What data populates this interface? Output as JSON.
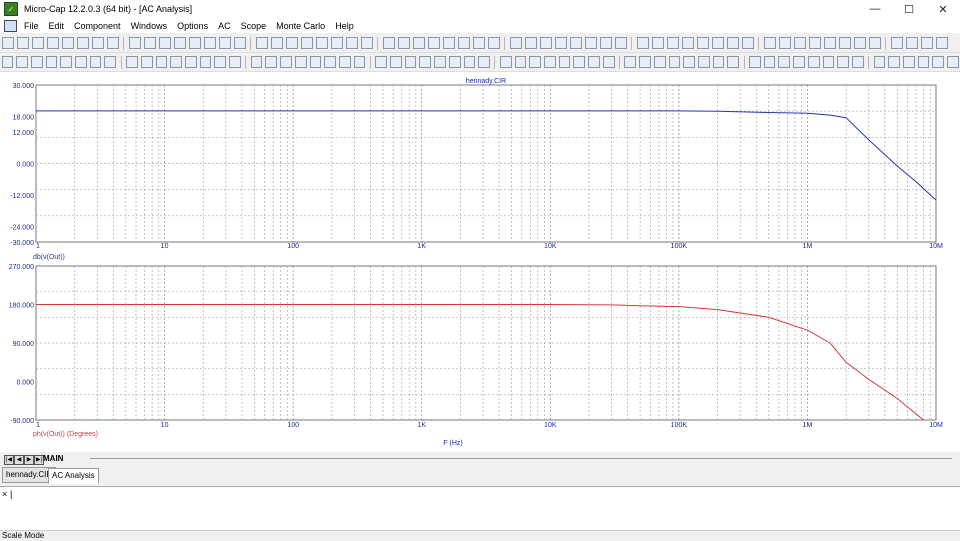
{
  "window": {
    "title": "Micro-Cap 12.2.0.3 (64 bit) - [AC Analysis]",
    "minimize": "—",
    "maximize": "☐",
    "close": "✕"
  },
  "menu": [
    "File",
    "Edit",
    "Component",
    "Windows",
    "Options",
    "AC",
    "Scope",
    "Monte Carlo",
    "Help"
  ],
  "toolbar1_count": 60,
  "toolbar2_count": 62,
  "plot": {
    "title": "hennady.CIR",
    "xlabel": "F (Hz)",
    "top_label": "db(v(Out))",
    "bottom_label": "ph(v(Out)) (Degrees)"
  },
  "chart_data": [
    {
      "type": "line",
      "title": "hennady.CIR",
      "xscale": "log",
      "xlim": [
        1,
        10000000
      ],
      "ylim": [
        -30,
        30
      ],
      "xticks": [
        "1",
        "10",
        "100",
        "1K",
        "10K",
        "100K",
        "1M",
        "10M"
      ],
      "yticks": [
        "30.000",
        "18.000",
        "12.000",
        "0.000",
        "-12.000",
        "-24.000",
        "-30.000"
      ],
      "ytick_values": [
        30,
        18,
        12,
        0,
        -12,
        -24,
        -30
      ],
      "ylabel": "db(v(Out))",
      "grid": true,
      "color": "#2b35b8",
      "series": [
        {
          "name": "db(v(Out))",
          "x": [
            1,
            10,
            100,
            1000,
            10000,
            100000,
            200000,
            500000,
            1000000,
            1500000,
            2000000,
            3000000,
            5000000,
            7000000,
            10000000
          ],
          "y": [
            20.1,
            20.1,
            20.1,
            20.1,
            20.1,
            20.1,
            20.0,
            19.5,
            19.2,
            18.5,
            17.5,
            9.0,
            -1.0,
            -7.0,
            -14.0
          ]
        }
      ]
    },
    {
      "type": "line",
      "xscale": "log",
      "xlim": [
        1,
        10000000
      ],
      "ylim": [
        -90,
        270
      ],
      "xticks": [
        "1",
        "10",
        "100",
        "1K",
        "10K",
        "100K",
        "1M",
        "10M"
      ],
      "yticks": [
        "270.000",
        "180.000",
        "90.000",
        "0.000",
        "-90.000"
      ],
      "ytick_values": [
        270,
        180,
        90,
        0,
        -90
      ],
      "ylabel": "ph(v(Out)) (Degrees)",
      "xlabel": "F (Hz)",
      "grid": true,
      "color": "#d83a3a",
      "series": [
        {
          "name": "ph(v(Out)) (Degrees)",
          "x": [
            1,
            10,
            100,
            1000,
            10000,
            30000,
            50000,
            100000,
            200000,
            500000,
            1000000,
            1500000,
            2000000,
            3000000,
            5000000,
            8000000
          ],
          "y": [
            180,
            180,
            180,
            180,
            180,
            179,
            177,
            175,
            168,
            150,
            120,
            90,
            45,
            5,
            -40,
            -90
          ]
        }
      ]
    }
  ],
  "tabs": {
    "main": "MAIN",
    "docs": [
      "hennady.CIR",
      "AC Analysis"
    ]
  },
  "command": {
    "close": "×",
    "caret": "|"
  },
  "status": "Scale Mode"
}
